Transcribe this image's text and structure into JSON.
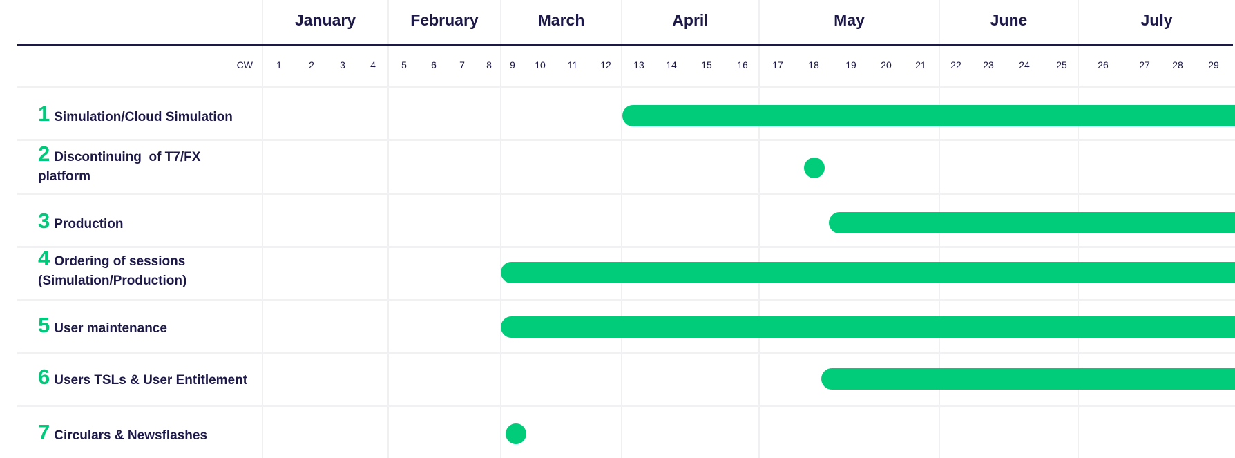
{
  "chart_data": {
    "type": "gantt",
    "title": "",
    "x_axis_label": "CW",
    "months": [
      "January",
      "February",
      "March",
      "April",
      "May",
      "June",
      "July"
    ],
    "weeks": [
      1,
      2,
      3,
      4,
      5,
      6,
      7,
      8,
      9,
      10,
      11,
      12,
      13,
      14,
      15,
      16,
      17,
      18,
      19,
      20,
      21,
      22,
      23,
      24,
      25,
      26,
      27,
      28,
      29
    ],
    "visible_week_range": [
      1,
      29
    ],
    "colors": {
      "bar": "#00cc7a",
      "number": "#00c97b",
      "text": "#1c1847",
      "rule": "#1c1847",
      "grid": "#f0f0f3"
    },
    "tasks": [
      {
        "num": "1",
        "label": "Simulation/Cloud Simulation",
        "type": "bar",
        "start_week": 13.0,
        "end_week": "beyond 29"
      },
      {
        "num": "2",
        "label": "Discontinuing  of T7/FX platform",
        "type": "milestone",
        "week": 18.5
      },
      {
        "num": "3",
        "label": "Production",
        "type": "bar",
        "start_week": 18.9,
        "end_week": "beyond 29"
      },
      {
        "num": "4",
        "label": "Ordering of sessions (Simulation/Production)",
        "type": "bar",
        "start_week": 9.0,
        "end_week": "beyond 29"
      },
      {
        "num": "5",
        "label": "User maintenance",
        "type": "bar",
        "start_week": 9.0,
        "end_week": "beyond 29"
      },
      {
        "num": "6",
        "label": "Users TSLs & User Entitlement",
        "type": "bar",
        "start_week": 18.7,
        "end_week": "beyond 29"
      },
      {
        "num": "7",
        "label": "Circulars & Newsflashes",
        "type": "milestone",
        "week": 9.6
      }
    ]
  }
}
